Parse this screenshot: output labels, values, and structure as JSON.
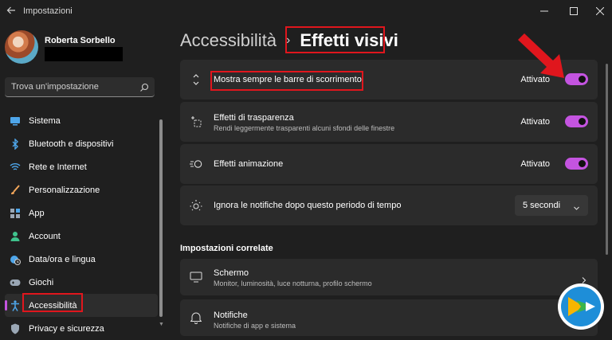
{
  "window": {
    "title": "Impostazioni"
  },
  "user": {
    "name": "Roberta Sorbello"
  },
  "search": {
    "placeholder": "Trova un'impostazione"
  },
  "sidebar": {
    "items": [
      {
        "label": "Sistema",
        "icon": "monitor-icon"
      },
      {
        "label": "Bluetooth e dispositivi",
        "icon": "bluetooth-icon"
      },
      {
        "label": "Rete e Internet",
        "icon": "wifi-icon"
      },
      {
        "label": "Personalizzazione",
        "icon": "brush-icon"
      },
      {
        "label": "App",
        "icon": "apps-icon"
      },
      {
        "label": "Account",
        "icon": "person-icon"
      },
      {
        "label": "Data/ora e lingua",
        "icon": "globe-clock-icon"
      },
      {
        "label": "Giochi",
        "icon": "gamepad-icon"
      },
      {
        "label": "Accessibilità",
        "icon": "accessibility-icon"
      },
      {
        "label": "Privacy e sicurezza",
        "icon": "shield-icon"
      }
    ],
    "active_index": 8
  },
  "breadcrumb": {
    "parent": "Accessibilità",
    "separator": "›",
    "current": "Effetti visivi"
  },
  "settings": [
    {
      "title": "Mostra sempre le barre di scorrimento",
      "subtitle": "",
      "state": "Attivato",
      "control": "toggle",
      "icon": "scrollbar-icon"
    },
    {
      "title": "Effetti di trasparenza",
      "subtitle": "Rendi leggermente trasparenti alcuni sfondi delle finestre",
      "state": "Attivato",
      "control": "toggle",
      "icon": "transparency-icon"
    },
    {
      "title": "Effetti animazione",
      "subtitle": "",
      "state": "Attivato",
      "control": "toggle",
      "icon": "animation-icon"
    },
    {
      "title": "Ignora le notifiche dopo questo periodo di tempo",
      "subtitle": "",
      "value": "5 secondi",
      "control": "dropdown",
      "icon": "sun-icon"
    }
  ],
  "related": {
    "title": "Impostazioni correlate",
    "items": [
      {
        "title": "Schermo",
        "subtitle": "Monitor, luminosità, luce notturna, profilo schermo",
        "icon": "display-icon"
      },
      {
        "title": "Notifiche",
        "subtitle": "Notifiche di app e sistema",
        "icon": "bell-icon"
      }
    ]
  },
  "colors": {
    "accent": "#c454e0",
    "highlight": "#e0161d",
    "background": "#1f1f1f",
    "card": "#2b2b2b"
  }
}
